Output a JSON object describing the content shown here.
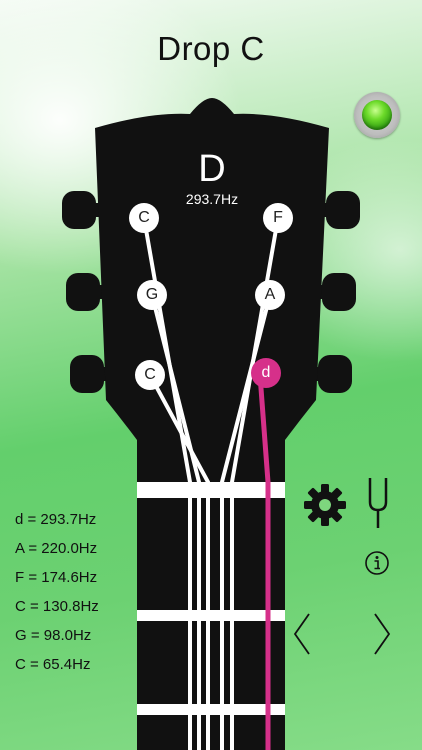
{
  "header": {
    "title": "Drop C"
  },
  "headstock": {
    "note": "D",
    "frequency": "293.7Hz"
  },
  "pegs": {
    "left_top": "C",
    "left_middle": "G",
    "left_bottom": "C",
    "right_top": "F",
    "right_middle": "A",
    "right_bottom": "d"
  },
  "frequency_list": [
    "d = 293.7Hz",
    "A = 220.0Hz",
    "F = 174.6Hz",
    "C = 130.8Hz",
    "G = 98.0Hz",
    "C = 65.4Hz"
  ],
  "icons": {
    "status": "status-light-icon",
    "settings": "gear-icon",
    "tuning_fork": "tuning-fork-icon",
    "info": "info-icon",
    "previous": "chevron-left-icon",
    "next": "chevron-right-icon"
  },
  "colors": {
    "active_string": "#d6308a",
    "status_light": "#5ad21f"
  }
}
